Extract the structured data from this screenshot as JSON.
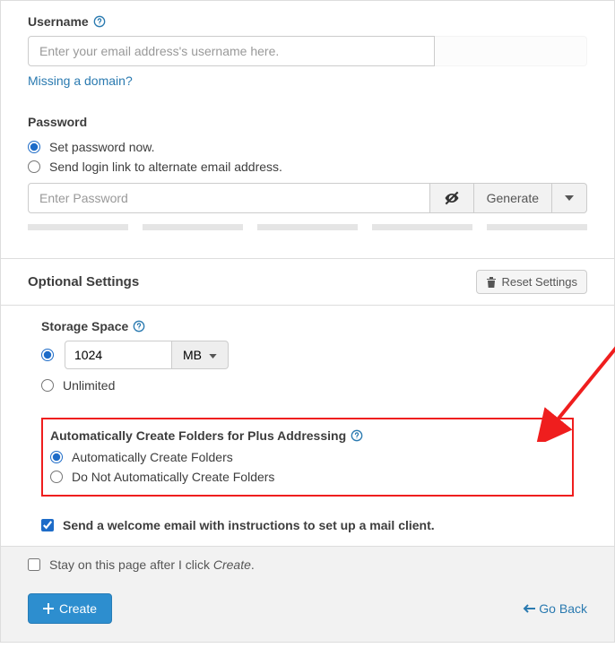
{
  "username": {
    "label": "Username",
    "placeholder": "Enter your email address's username here.",
    "missing_link": "Missing a domain?"
  },
  "password": {
    "label": "Password",
    "opt_now": "Set password now.",
    "opt_link": "Send login link to alternate email address.",
    "placeholder": "Enter Password",
    "generate": "Generate"
  },
  "optional": {
    "title": "Optional Settings",
    "reset": "Reset Settings",
    "storage": {
      "label": "Storage Space",
      "value": "1024",
      "unit": "MB",
      "unlimited": "Unlimited"
    },
    "plus": {
      "label": "Automatically Create Folders for Plus Addressing",
      "opt_auto": "Automatically Create Folders",
      "opt_no": "Do Not Automatically Create Folders"
    },
    "welcome": "Send a welcome email with instructions to set up a mail client."
  },
  "footer": {
    "stay_pre": "Stay on this page after I click ",
    "stay_em": "Create",
    "stay_post": ".",
    "create": "Create",
    "goback": "Go Back"
  }
}
